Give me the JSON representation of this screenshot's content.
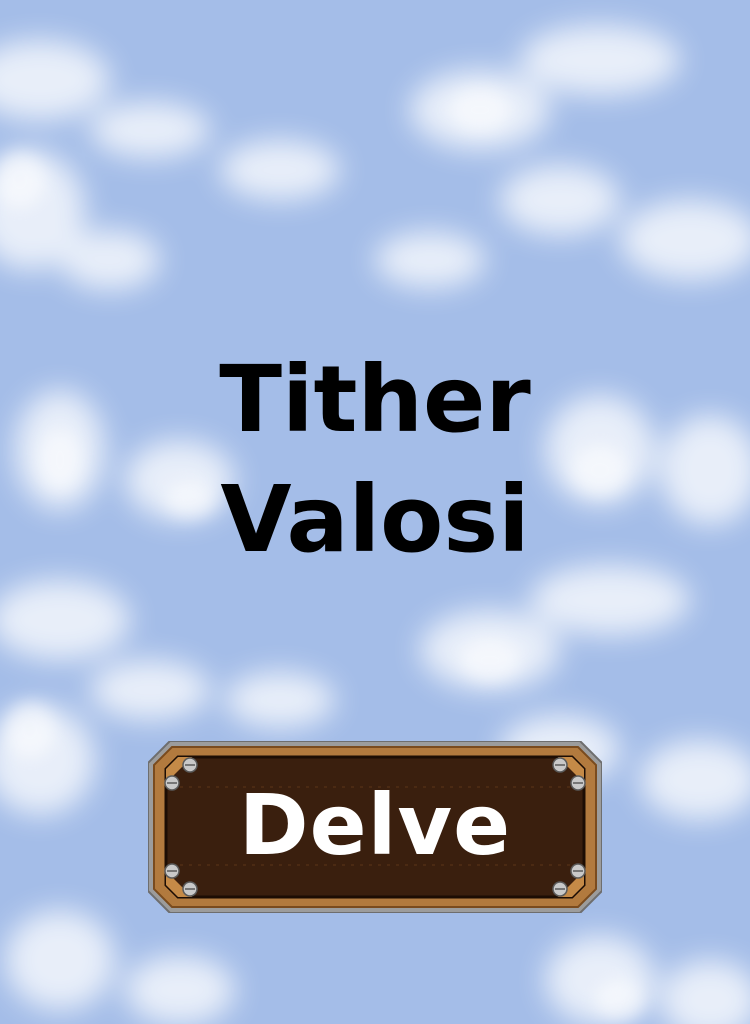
{
  "title": {
    "line1": "Tither",
    "line2": "Valosi"
  },
  "delve_button": {
    "label": "Delve"
  },
  "colors": {
    "sky": "#a4bde8",
    "cloud": "#ffffff",
    "button_fill": "#3a1f0e",
    "button_frame": "#b27a3e",
    "button_frame_outer": "#9c9c9c",
    "title_text": "#000000",
    "button_text": "#ffffff"
  },
  "icons": [
    "bolt-icon"
  ]
}
